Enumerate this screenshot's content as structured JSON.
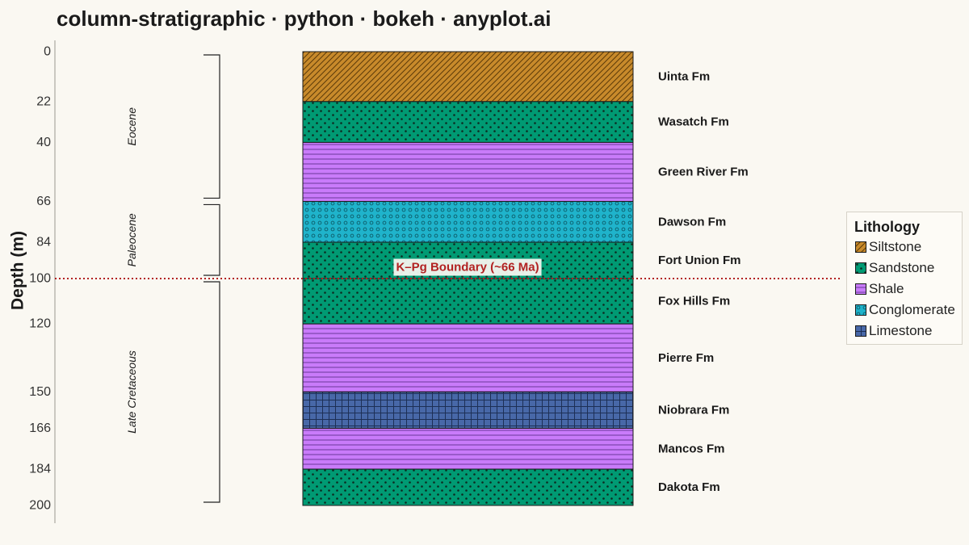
{
  "title": "column-stratigraphic · python · bokeh · anyplot.ai",
  "chart_data": {
    "type": "stratigraphic-column",
    "ylabel": "Depth (m)",
    "yticks": [
      0,
      22,
      40,
      66,
      84,
      100,
      120,
      150,
      166,
      184,
      200
    ],
    "ylim": [
      0,
      200
    ],
    "y_inverted": true,
    "layers": [
      {
        "formation": "Uinta Fm",
        "lithology": "Siltstone",
        "top": 0,
        "bottom": 22
      },
      {
        "formation": "Wasatch Fm",
        "lithology": "Sandstone",
        "top": 22,
        "bottom": 40
      },
      {
        "formation": "Green River Fm",
        "lithology": "Shale",
        "top": 40,
        "bottom": 66
      },
      {
        "formation": "Dawson Fm",
        "lithology": "Conglomerate",
        "top": 66,
        "bottom": 84
      },
      {
        "formation": "Fort Union Fm",
        "lithology": "Sandstone",
        "top": 84,
        "bottom": 100
      },
      {
        "formation": "Fox Hills Fm",
        "lithology": "Sandstone",
        "top": 100,
        "bottom": 120
      },
      {
        "formation": "Pierre Fm",
        "lithology": "Shale",
        "top": 120,
        "bottom": 150
      },
      {
        "formation": "Niobrara Fm",
        "lithology": "Limestone",
        "top": 150,
        "bottom": 166
      },
      {
        "formation": "Mancos Fm",
        "lithology": "Shale",
        "top": 166,
        "bottom": 184
      },
      {
        "formation": "Dakota Fm",
        "lithology": "Sandstone",
        "top": 184,
        "bottom": 200
      }
    ],
    "epochs": [
      {
        "name": "Eocene",
        "top": 0,
        "bottom": 66
      },
      {
        "name": "Paleocene",
        "top": 66,
        "bottom": 100
      },
      {
        "name": "Late Cretaceous",
        "top": 100,
        "bottom": 200
      }
    ],
    "annotations": [
      {
        "text": "K–Pg Boundary  (~66 Ma)",
        "depth": 100,
        "color": "#B22222"
      }
    ],
    "legend": {
      "title": "Lithology",
      "placement": "right",
      "items": [
        {
          "label": "Siltstone",
          "color": "#C88A2B"
        },
        {
          "label": "Sandstone",
          "color": "#009A73"
        },
        {
          "label": "Shale",
          "color": "#C97BFA"
        },
        {
          "label": "Conglomerate",
          "color": "#1FB3CB"
        },
        {
          "label": "Limestone",
          "color": "#4868A8"
        }
      ]
    }
  }
}
